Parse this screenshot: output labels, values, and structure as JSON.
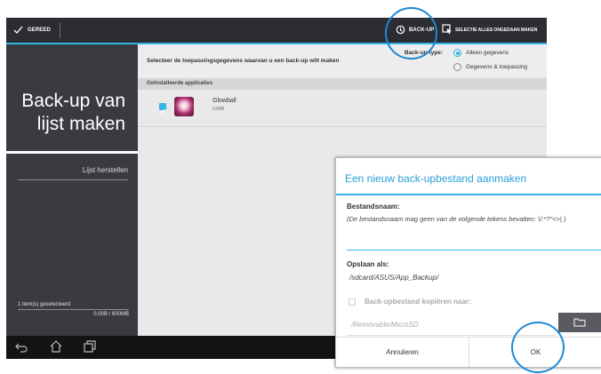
{
  "topbar": {
    "done_label": "GEREED",
    "backup_label": "BACK-UP",
    "deselect_label": "SELECTIE ALLES ONGEDAAN MAKEN"
  },
  "sidebar": {
    "title_line1": "Back-up van",
    "title_line2": "lijst maken",
    "restore_label": "Lijst herstellen",
    "selected_count": "1 item(s) geselecteerd",
    "storage": "0,00B / 600MB",
    "storage_fraction": 0.0
  },
  "content": {
    "instruction": "Selecteer de toepassingsgegevens waarvan u een back-up wilt maken",
    "backup_type_label": "Back-up type:",
    "option_data_only": "Alleen gegevens",
    "option_data_and_app": "Gegevens & toepassing",
    "selected_option": "Alleen gegevens",
    "section_header": "Geïnstalleerde applicaties",
    "apps": [
      {
        "name": "Glowball",
        "size": "0,00B",
        "checked": true
      }
    ]
  },
  "dialog": {
    "title": "Een nieuw back-upbestand aanmaken",
    "filename_label": "Bestandsnaam:",
    "filename_hint": "(De bestandsnaam mag geen van de volgende tekens bevatten: \\/:*?\"<>| )",
    "filename_value": "",
    "save_as_label": "Opslaan als:",
    "save_path": "/sdcard/ASUS/App_Backup/",
    "copy_label": "Back-upbestand kopiëren naar:",
    "copy_path": "/Removable/MicroSD",
    "cancel_label": "Annuleren",
    "ok_label": "OK"
  },
  "colors": {
    "accent": "#33b5e5",
    "highlight_circle": "#1e88d6",
    "dialog_title": "#2a9fd6",
    "sidebar_bg": "#3a3b41",
    "topbar_bg": "#2b2d32"
  },
  "icons": [
    "check-icon",
    "backup-icon",
    "deselect-icon",
    "app-glowball-icon",
    "folder-icon",
    "back-icon",
    "home-icon",
    "recent-apps-icon"
  ]
}
